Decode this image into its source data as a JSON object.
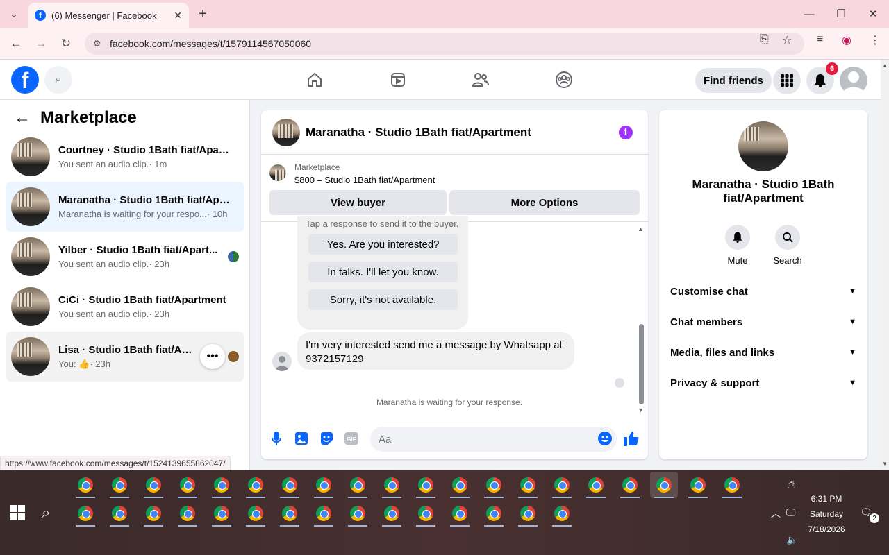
{
  "browser": {
    "tab_title": "(6) Messenger | Facebook",
    "url": "facebook.com/messages/t/1579114567050060",
    "status_url": "https://www.facebook.com/messages/t/1524139655862047/"
  },
  "header": {
    "find_friends": "Find friends",
    "notification_count": "6"
  },
  "left": {
    "title": "Marketplace",
    "conversations": [
      {
        "name": "Courtney · Studio 1Bath fiat/Apart...",
        "preview": "You sent an audio clip.",
        "time": " · 1m"
      },
      {
        "name": "Maranatha · Studio 1Bath fiat/Apa...",
        "preview": "Maranatha is waiting for your respo...",
        "time": " · 10h"
      },
      {
        "name": "Yilber · Studio 1Bath fiat/Apart...",
        "preview": "You sent an audio clip.",
        "time": " · 23h"
      },
      {
        "name": "CiCi · Studio 1Bath fiat/Apartment",
        "preview": "You sent an audio clip.",
        "time": " · 23h"
      },
      {
        "name": "Lisa · Studio 1Bath fiat/Apartme",
        "preview": "You: 👍",
        "time": " · 23h"
      }
    ]
  },
  "chat": {
    "title": "Maranatha · Studio 1Bath fiat/Apartment",
    "marketplace_label": "Marketplace",
    "listing": "$800 – Studio 1Bath fiat/Apartment",
    "view_buyer": "View buyer",
    "more_options": "More Options",
    "quick_hint": "Tap a response to send it to the buyer.",
    "quick_replies": [
      "Yes. Are you interested?",
      "In talks. I'll let you know.",
      "Sorry, it's not available."
    ],
    "message": "I'm very interested send me a message by Whatsapp at 9372157129",
    "waiting": "Maranatha is waiting for your response.",
    "input_placeholder": "Aa"
  },
  "right": {
    "title": "Maranatha · Studio 1Bath fiat/Apartment",
    "mute": "Mute",
    "search": "Search",
    "rows": [
      "Customise chat",
      "Chat members",
      "Media, files and links",
      "Privacy & support"
    ]
  },
  "taskbar": {
    "time": "6:31 PM",
    "day": "Saturday",
    "date": "7/18/2026",
    "notif_count": "2"
  }
}
